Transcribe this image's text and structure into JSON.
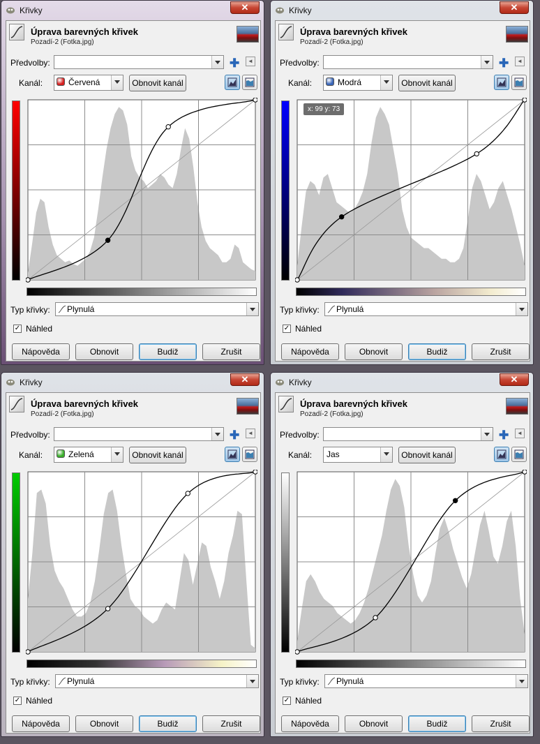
{
  "windows": [
    {
      "title": "Křivky",
      "close": "✕",
      "header": {
        "title": "Úprava barevných křivek",
        "subtitle": "Pozadí-2 (Fotka.jpg)"
      },
      "presets_label": "Předvolby:",
      "preset_value": "",
      "channel_label": "Kanál:",
      "channel_value": "Červená",
      "channel_icon_color": "#d62020",
      "reset_channel": "Obnovit kanál",
      "curve_type_label": "Typ křivky:",
      "curve_type_value": "Plynulá",
      "preview_label": "Náhled",
      "preview_checked": true,
      "tooltip": "",
      "buttons": {
        "help": "Nápověda",
        "reset": "Obnovit",
        "ok": "Budiž",
        "cancel": "Zrušit"
      },
      "accent": "#ff0000"
    },
    {
      "title": "Křivky",
      "close": "✕",
      "header": {
        "title": "Úprava barevných křivek",
        "subtitle": "Pozadí-2 (Fotka.jpg)"
      },
      "presets_label": "Předvolby:",
      "preset_value": "",
      "channel_label": "Kanál:",
      "channel_value": "Modrá",
      "channel_icon_color": "#3a66b8",
      "reset_channel": "Obnovit kanál",
      "curve_type_label": "Typ křivky:",
      "curve_type_value": "Plynulá",
      "preview_label": "Náhled",
      "preview_checked": true,
      "tooltip": "x: 99 y: 73",
      "buttons": {
        "help": "Nápověda",
        "reset": "Obnovit",
        "ok": "Budiž",
        "cancel": "Zrušit"
      },
      "accent": "#0000ff"
    },
    {
      "title": "Křivky",
      "close": "✕",
      "header": {
        "title": "Úprava barevných křivek",
        "subtitle": "Pozadí-2 (Fotka.jpg)"
      },
      "presets_label": "Předvolby:",
      "preset_value": "",
      "channel_label": "Kanál:",
      "channel_value": "Zelená",
      "channel_icon_color": "#3aae2a",
      "reset_channel": "Obnovit kanál",
      "curve_type_label": "Typ křivky:",
      "curve_type_value": "Plynulá",
      "preview_label": "Náhled",
      "preview_checked": true,
      "tooltip": "",
      "buttons": {
        "help": "Nápověda",
        "reset": "Obnovit",
        "ok": "Budiž",
        "cancel": "Zrušit"
      },
      "accent": "#00cc00"
    },
    {
      "title": "Křivky",
      "close": "✕",
      "header": {
        "title": "Úprava barevných křivek",
        "subtitle": "Pozadí-2 (Fotka.jpg)"
      },
      "presets_label": "Předvolby:",
      "preset_value": "",
      "channel_label": "Kanál:",
      "channel_value": "Jas",
      "channel_icon_color": "",
      "reset_channel": "Obnovit kanál",
      "curve_type_label": "Typ křivky:",
      "curve_type_value": "Plynulá",
      "preview_label": "Náhled",
      "preview_checked": true,
      "tooltip": "",
      "buttons": {
        "help": "Nápověda",
        "reset": "Obnovit",
        "ok": "Budiž",
        "cancel": "Zrušit"
      },
      "accent": "#ffffff"
    }
  ]
}
